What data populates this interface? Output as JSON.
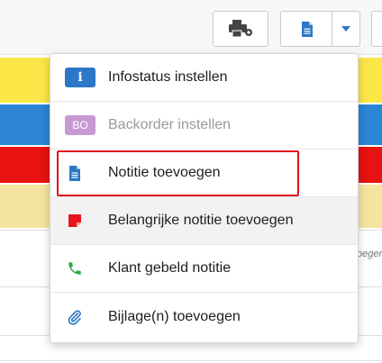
{
  "menu": {
    "items": [
      {
        "label": "Infostatus instellen",
        "icon": "info-icon",
        "icon_text": "i",
        "disabled": false
      },
      {
        "label": "Backorder instellen",
        "icon": "backorder-badge-icon",
        "icon_text": "BO",
        "disabled": true
      },
      {
        "label": "Notitie toevoegen",
        "icon": "document-icon",
        "highlighted": true
      },
      {
        "label": "Belangrijke notitie toevoegen",
        "icon": "important-note-icon",
        "hovered": true
      },
      {
        "label": "Klant gebeld notitie",
        "icon": "phone-icon"
      },
      {
        "label": "Bijlage(n) toevoegen",
        "icon": "paperclip-icon"
      }
    ]
  },
  "background": {
    "edge_text": "oeger"
  },
  "colors": {
    "accent_blue": "#2b78c8",
    "band_yellow": "#fbe748",
    "band_blue": "#2b84d6",
    "band_red": "#e81212",
    "band_cream": "#f5e4a0",
    "highlight_red": "#e0141b",
    "phone_green": "#2eae45",
    "important_red": "#e8141b",
    "bo_purple": "#c79ad6"
  }
}
